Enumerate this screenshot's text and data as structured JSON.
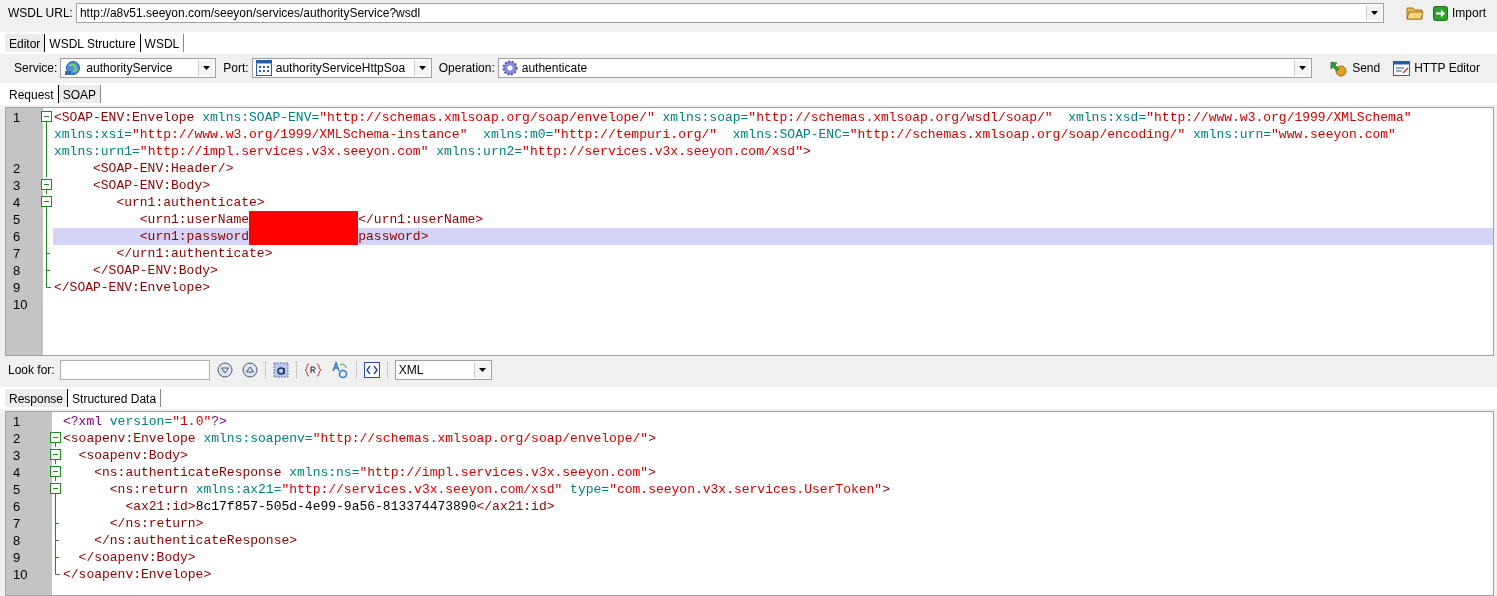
{
  "url_bar": {
    "label": "WSDL URL:",
    "value": "http://a8v51.seeyon.com/seeyon/services/authorityService?wsdl",
    "import_button": "Import"
  },
  "editor_tabs": [
    {
      "label": "Editor",
      "selected": true
    },
    {
      "label": "WSDL Structure",
      "selected": false
    },
    {
      "label": "WSDL",
      "selected": false
    }
  ],
  "operation_bar": {
    "service_label": "Service:",
    "service": "authorityService",
    "port_label": "Port:",
    "port": "authorityServiceHttpSoa",
    "operation_label": "Operation:",
    "operation": "authenticate",
    "send_button": "Send",
    "http_editor_button": "HTTP Editor"
  },
  "request_tabs": [
    {
      "label": "Request",
      "selected": false
    },
    {
      "label": "SOAP",
      "selected": true
    }
  ],
  "request_editor": {
    "lines": [
      {
        "number": "1",
        "kind": "block_start",
        "current": false,
        "parts": [
          {
            "tokens": [
              {
                "kind": "tag",
                "text": "<SOAP-ENV:Envelope"
              },
              {
                "kind": "attr",
                "text": " xmlns:SOAP-ENV="
              },
              {
                "kind": "value",
                "text": "\"http://schemas.xmlsoap.org/soap/envelope/\""
              },
              {
                "kind": "attr",
                "text": " xmlns:soap="
              },
              {
                "kind": "value",
                "text": "\"http://schemas.xmlsoap.org/wsdl/soap/\""
              },
              {
                "kind": "attr",
                "text": "  xmlns:xsd="
              },
              {
                "kind": "value",
                "text": "\"http://www.w3.org/1999/XMLSchema\""
              }
            ]
          },
          {
            "tokens": [
              {
                "kind": "attr",
                "text": "xmlns:xsi="
              },
              {
                "kind": "value",
                "text": "\"http://www.w3.org/1999/XMLSchema-instance\""
              },
              {
                "kind": "attr",
                "text": "  xmlns:m0="
              },
              {
                "kind": "value",
                "text": "\"http://tempuri.org/\""
              },
              {
                "kind": "attr",
                "text": "  xmlns:SOAP-ENC="
              },
              {
                "kind": "value",
                "text": "\"http://schemas.xmlsoap.org/soap/encoding/\""
              },
              {
                "kind": "attr",
                "text": " xmlns:urn="
              },
              {
                "kind": "value",
                "text": "\"www.seeyon.com\""
              }
            ]
          },
          {
            "tokens": [
              {
                "kind": "attr",
                "text": "xmlns:urn1="
              },
              {
                "kind": "value",
                "text": "\"http://impl.services.v3x.seeyon.com\""
              },
              {
                "kind": "attr",
                "text": " xmlns:urn2="
              },
              {
                "kind": "value",
                "text": "\"http://services.v3x.seeyon.com/xsd\""
              },
              {
                "kind": "tag",
                "text": ">"
              }
            ]
          }
        ]
      },
      {
        "number": "2",
        "kind": "guide",
        "current": false,
        "parts": [
          {
            "tokens": [
              {
                "kind": "tag",
                "text": "     <SOAP-ENV:Header/>"
              }
            ]
          }
        ]
      },
      {
        "number": "3",
        "kind": "block_start",
        "current": false,
        "parts": [
          {
            "tokens": [
              {
                "kind": "tag",
                "text": "     <SOAP-ENV:Body>"
              }
            ]
          }
        ]
      },
      {
        "number": "4",
        "kind": "block_start",
        "current": false,
        "parts": [
          {
            "tokens": [
              {
                "kind": "tag",
                "text": "        <urn1:authenticate>"
              }
            ]
          }
        ]
      },
      {
        "number": "5",
        "kind": "guide",
        "current": false,
        "parts": [
          {
            "tokens": [
              {
                "kind": "tag",
                "text": "           <urn1:userName"
              },
              {
                "kind": "redacted"
              },
              {
                "kind": "tag",
                "text": "</urn1:userName>"
              }
            ]
          }
        ]
      },
      {
        "number": "6",
        "kind": "guide",
        "current": true,
        "parts": [
          {
            "tokens": [
              {
                "kind": "tag",
                "text": "           <urn1:password"
              },
              {
                "kind": "redacted"
              },
              {
                "kind": "tag",
                "text": "password>"
              }
            ]
          }
        ]
      },
      {
        "number": "7",
        "kind": "block_inner",
        "current": false,
        "parts": [
          {
            "tokens": [
              {
                "kind": "tag",
                "text": "        </urn1:authenticate>"
              }
            ]
          }
        ]
      },
      {
        "number": "8",
        "kind": "block_inner",
        "current": false,
        "parts": [
          {
            "tokens": [
              {
                "kind": "tag",
                "text": "     </SOAP-ENV:Body>"
              }
            ]
          }
        ]
      },
      {
        "number": "9",
        "kind": "block_end",
        "current": false,
        "parts": [
          {
            "tokens": [
              {
                "kind": "tag",
                "text": "</SOAP-ENV:Envelope>"
              }
            ]
          }
        ]
      },
      {
        "number": "10",
        "kind": "plain",
        "current": false
      }
    ]
  },
  "search_bar": {
    "label": "Look for:",
    "syntax": "XML"
  },
  "response_tabs": [
    {
      "label": "Response",
      "selected": true
    },
    {
      "label": "Structured Data",
      "selected": false
    }
  ],
  "response_editor": {
    "lines": [
      {
        "number": "1",
        "kind": "plain",
        "current": false,
        "parts": [
          {
            "tokens": [
              {
                "kind": "pi",
                "text": "<?xml"
              },
              {
                "kind": "attr",
                "text": " version="
              },
              {
                "kind": "value",
                "text": "\"1.0\""
              },
              {
                "kind": "pi",
                "text": "?>"
              }
            ]
          }
        ]
      },
      {
        "number": "2",
        "kind": "block_start",
        "current": false,
        "parts": [
          {
            "tokens": [
              {
                "kind": "tag",
                "text": "<soapenv:Envelope"
              },
              {
                "kind": "attr",
                "text": " xmlns:soapenv="
              },
              {
                "kind": "value",
                "text": "\"http://schemas.xmlsoap.org/soap/envelope/\""
              },
              {
                "kind": "tag",
                "text": ">"
              }
            ]
          }
        ]
      },
      {
        "number": "3",
        "kind": "block_start",
        "current": false,
        "parts": [
          {
            "tokens": [
              {
                "kind": "tag",
                "text": "  <soapenv:Body>"
              }
            ]
          }
        ]
      },
      {
        "number": "4",
        "kind": "block_start",
        "current": false,
        "parts": [
          {
            "tokens": [
              {
                "kind": "tag",
                "text": "    <ns:authenticateResponse"
              },
              {
                "kind": "attr",
                "text": " xmlns:ns="
              },
              {
                "kind": "value",
                "text": "\"http://impl.services.v3x.seeyon.com\""
              },
              {
                "kind": "tag",
                "text": ">"
              }
            ]
          }
        ]
      },
      {
        "number": "5",
        "kind": "block_start",
        "current": false,
        "parts": [
          {
            "tokens": [
              {
                "kind": "tag",
                "text": "      <ns:return"
              },
              {
                "kind": "attr",
                "text": " xmlns:ax21="
              },
              {
                "kind": "value",
                "text": "\"http://services.v3x.seeyon.com/xsd\""
              },
              {
                "kind": "attr",
                "text": " type="
              },
              {
                "kind": "value",
                "text": "\"com.seeyon.v3x.services.UserToken\""
              },
              {
                "kind": "tag",
                "text": ">"
              }
            ]
          }
        ]
      },
      {
        "number": "6",
        "kind": "guide",
        "current": false,
        "parts": [
          {
            "tokens": [
              {
                "kind": "tag",
                "text": "        <ax21:id>"
              },
              {
                "kind": "text",
                "text": "8c17f857-505d-4e99-9a56-813374473890"
              },
              {
                "kind": "tag",
                "text": "</ax21:id>"
              }
            ]
          }
        ]
      },
      {
        "number": "7",
        "kind": "block_inner",
        "current": false,
        "parts": [
          {
            "tokens": [
              {
                "kind": "tag",
                "text": "      </ns:return>"
              }
            ]
          }
        ]
      },
      {
        "number": "8",
        "kind": "block_inner",
        "current": false,
        "parts": [
          {
            "tokens": [
              {
                "kind": "tag",
                "text": "    </ns:authenticateResponse>"
              }
            ]
          }
        ]
      },
      {
        "number": "9",
        "kind": "block_inner",
        "current": false,
        "parts": [
          {
            "tokens": [
              {
                "kind": "tag",
                "text": "  </soapenv:Body>"
              }
            ]
          }
        ]
      },
      {
        "number": "10",
        "kind": "block_end",
        "current": false,
        "parts": [
          {
            "tokens": [
              {
                "kind": "tag",
                "text": "</soapenv:Envelope>"
              }
            ]
          }
        ]
      }
    ]
  }
}
